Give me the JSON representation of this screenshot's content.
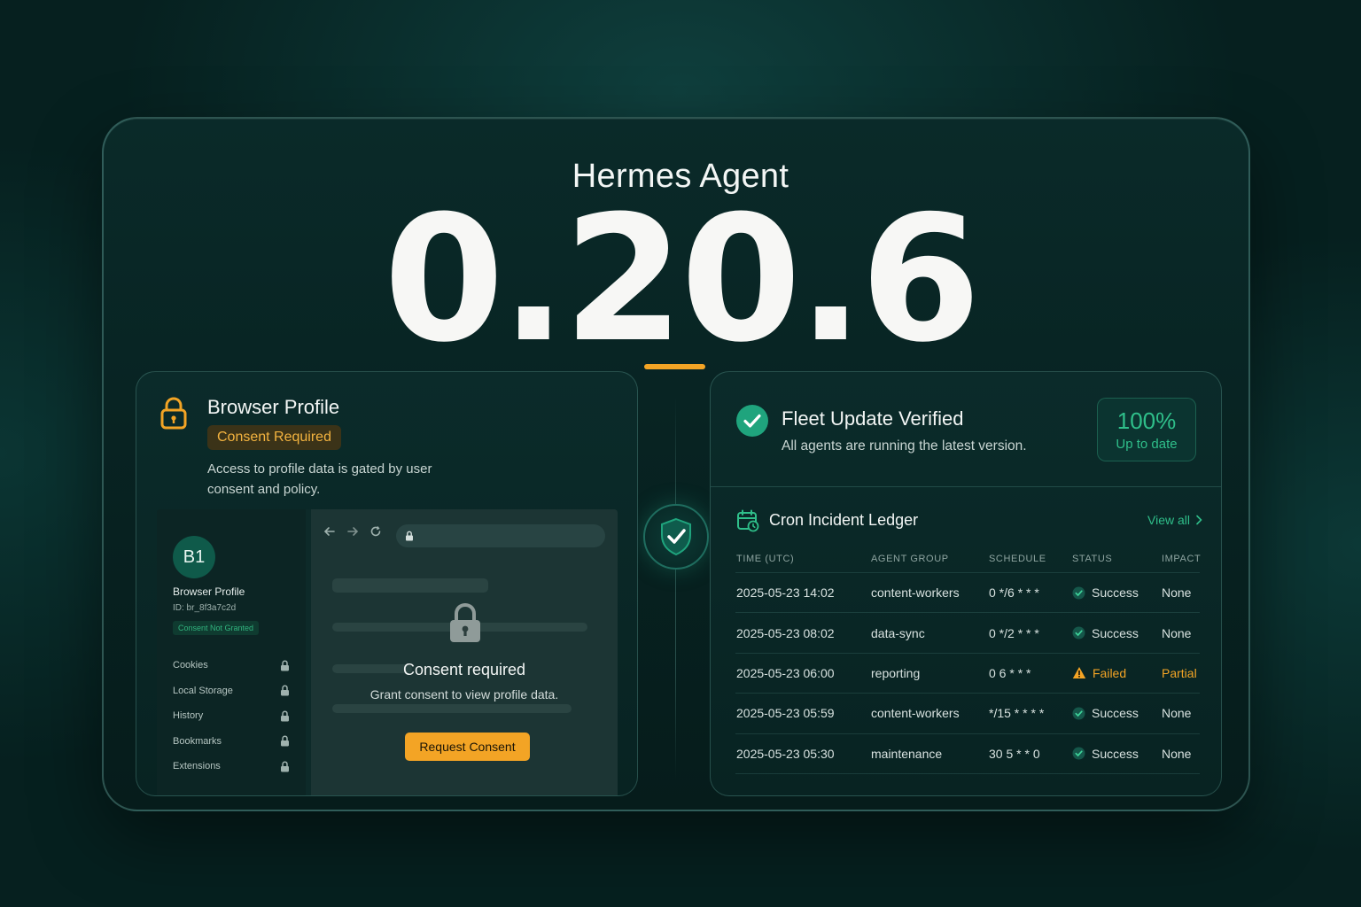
{
  "header": {
    "product": "Hermes Agent",
    "version": "0.20.6"
  },
  "colors": {
    "accent_orange": "#f3a425",
    "accent_green": "#2fbf8a",
    "background": "#06201f"
  },
  "browser_profile": {
    "title": "Browser Profile",
    "status_pill": "Consent Required",
    "description": "Access to profile data is gated by user consent and policy.",
    "mock": {
      "avatar": "B1",
      "name": "Browser Profile",
      "id": "ID: br_8f3a7c2d",
      "badge": "Consent Not Granted",
      "items": [
        {
          "label": "Cookies",
          "icon": "lock-icon"
        },
        {
          "label": "Local Storage",
          "icon": "lock-icon"
        },
        {
          "label": "History",
          "icon": "lock-icon"
        },
        {
          "label": "Bookmarks",
          "icon": "lock-icon"
        },
        {
          "label": "Extensions",
          "icon": "lock-icon"
        }
      ],
      "consent_title": "Consent required",
      "consent_desc": "Grant consent to view profile data.",
      "button": "Request Consent"
    }
  },
  "fleet": {
    "title": "Fleet Update Verified",
    "description": "All agents are running the latest version.",
    "percent": "100%",
    "percent_label": "Up to date"
  },
  "ledger": {
    "title": "Cron Incident Ledger",
    "view_all": "View all",
    "columns": [
      "TIME (UTC)",
      "AGENT GROUP",
      "SCHEDULE",
      "STATUS",
      "IMPACT"
    ],
    "rows": [
      {
        "time": "2025-05-23 14:02",
        "group": "content-workers",
        "schedule": "0 */6 * * *",
        "status": "Success",
        "impact": "None"
      },
      {
        "time": "2025-05-23 08:02",
        "group": "data-sync",
        "schedule": "0 */2 * * *",
        "status": "Success",
        "impact": "None"
      },
      {
        "time": "2025-05-23 06:00",
        "group": "reporting",
        "schedule": "0 6 * * *",
        "status": "Failed",
        "impact": "Partial"
      },
      {
        "time": "2025-05-23 05:59",
        "group": "content-workers",
        "schedule": "*/15 * * * *",
        "status": "Success",
        "impact": "None"
      },
      {
        "time": "2025-05-23 05:30",
        "group": "maintenance",
        "schedule": "30 5 * * 0",
        "status": "Success",
        "impact": "None"
      }
    ]
  }
}
